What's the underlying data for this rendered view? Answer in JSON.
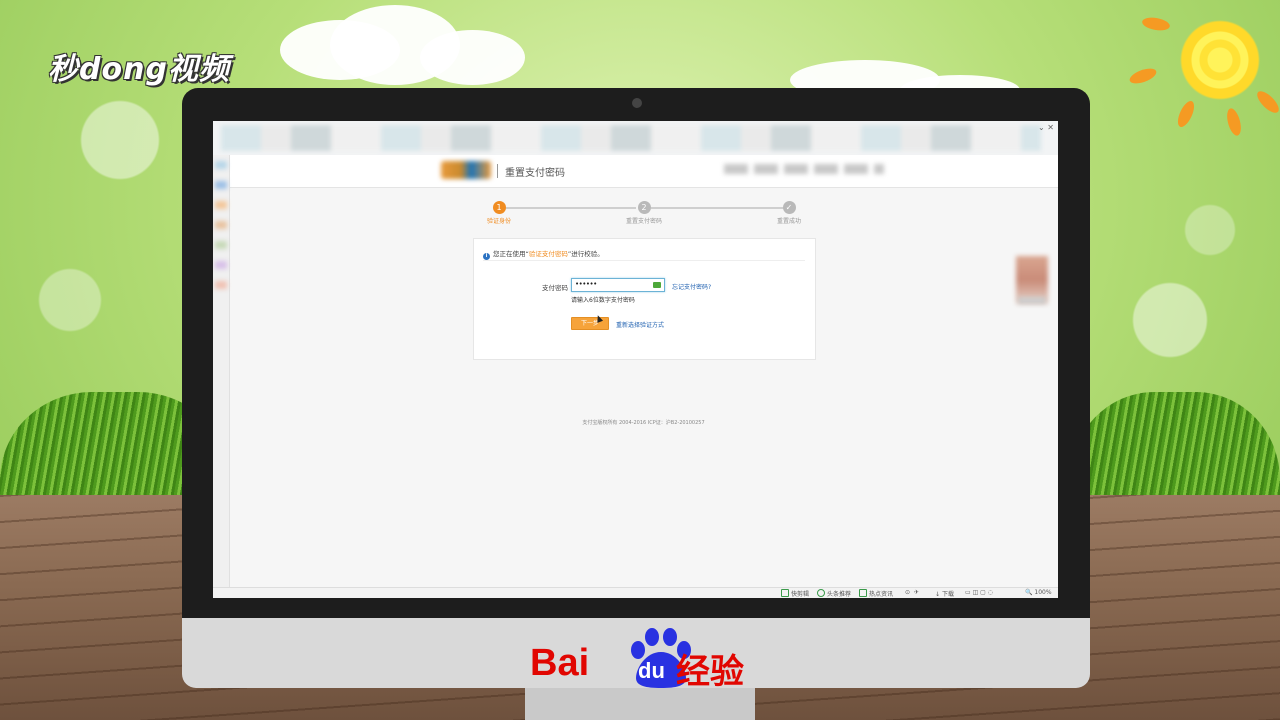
{
  "branding": {
    "watermark": "秒dong视频",
    "baidu_bai": "Bai",
    "baidu_du": "du",
    "baidu_jingyan": "经验"
  },
  "browser": {
    "window_controls": "⌄ ✕"
  },
  "site": {
    "header_title": "重置支付密码"
  },
  "steps": [
    {
      "number": "1",
      "label": "验证身份",
      "state": "active"
    },
    {
      "number": "2",
      "label": "重置支付密码",
      "state": "pending"
    },
    {
      "number": "✓",
      "label": "重置成功",
      "state": "pending"
    }
  ],
  "verify_form": {
    "notice_prefix": "您正在使用“",
    "notice_method": "验证支付密码",
    "notice_suffix": "”进行校验。",
    "password_label": "支付密码",
    "password_value": "••••••",
    "forgot_link": "忘记支付密码?",
    "password_hint": "请输入6位数字支付密码",
    "next_button": "下一步",
    "reselect_link": "重新选择验证方式"
  },
  "footer": {
    "copyright": "支付宝版权所有 2004-2016 ICP证：沪B2-20100257"
  },
  "status_bar": {
    "items": [
      "快剪辑",
      "头条推荐",
      "热点资讯",
      "下载",
      "100%"
    ]
  },
  "colors": {
    "accent_orange": "#f08c21",
    "link_blue": "#2061b0",
    "baidu_red": "#e10601",
    "baidu_blue": "#2932e1"
  }
}
